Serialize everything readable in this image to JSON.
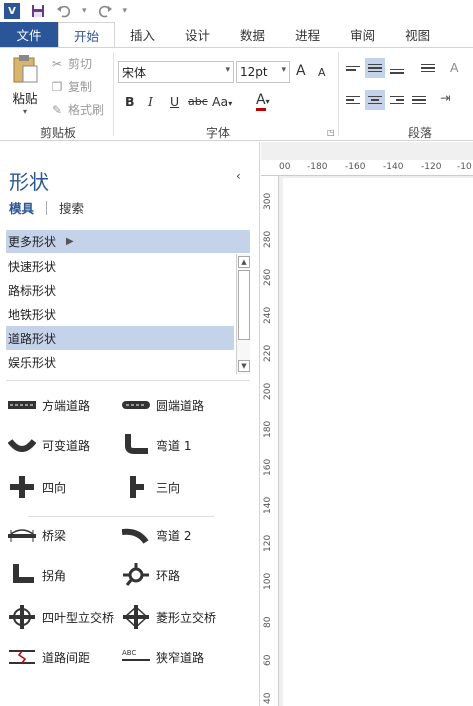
{
  "qat": {
    "app_icon": "V",
    "icons": [
      "visio-app-icon",
      "save-icon",
      "undo-icon",
      "redo-icon",
      "customize-icon"
    ]
  },
  "tabs": [
    "文件",
    "开始",
    "插入",
    "设计",
    "数据",
    "进程",
    "审阅",
    "视图"
  ],
  "ribbon": {
    "clipboard": {
      "paste": "粘贴",
      "cut": "剪切",
      "copy": "复制",
      "format_painter": "格式刷",
      "label": "剪贴板"
    },
    "font": {
      "name": "宋体",
      "size": "12pt",
      "grow": "A",
      "shrink": "A",
      "bold": "B",
      "italic": "I",
      "underline": "U",
      "strike": "abc",
      "case": "Aa",
      "color": "A",
      "label": "字体"
    },
    "paragraph": {
      "label": "段落"
    }
  },
  "panel": {
    "title": "形状",
    "tab_stencils": "模具",
    "tab_search": "搜索",
    "more": "更多形状",
    "list": [
      "快速形状",
      "路标形状",
      "地铁形状",
      "道路形状",
      "娱乐形状"
    ],
    "selected_index": 3,
    "shapes": [
      "方端道路",
      "圆端道路",
      "可变道路",
      "弯道 1",
      "四向",
      "三向",
      "桥梁",
      "弯道 2",
      "拐角",
      "环路",
      "四叶型立交桥",
      "菱形立交桥",
      "道路间距",
      "狭窄道路"
    ]
  },
  "ruler": {
    "h_ticks": [
      "00",
      "-180",
      "-160",
      "-140",
      "-120",
      "-10"
    ],
    "v_ticks": [
      "300",
      "280",
      "260",
      "240",
      "220",
      "200",
      "180",
      "160",
      "140",
      "120",
      "100",
      "80",
      "60",
      "40"
    ]
  },
  "colors": {
    "accent": "#2a5699",
    "selection": "#c5d3ea",
    "font_color": "#c00000"
  }
}
